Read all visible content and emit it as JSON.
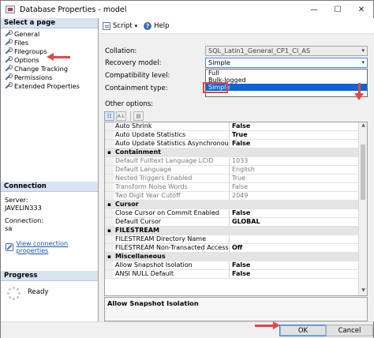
{
  "window": {
    "title": "Database Properties - model",
    "minimize": "—",
    "maximize": "☐",
    "close": "✕"
  },
  "left": {
    "select_page_header": "Select a page",
    "pages": [
      "General",
      "Files",
      "Filegroups",
      "Options",
      "Change Tracking",
      "Permissions",
      "Extended Properties"
    ],
    "connection_header": "Connection",
    "server_label": "Server:",
    "server_value": "JAVELIN333",
    "connection_label": "Connection:",
    "connection_value": "sa",
    "view_connection_link": "View connection properties",
    "progress_header": "Progress",
    "progress_status": "Ready"
  },
  "toolbar": {
    "script_label": "Script",
    "help_label": "Help"
  },
  "form": {
    "collation_label": "Collation:",
    "collation_value": "SQL_Latin1_General_CP1_CI_AS",
    "recovery_label": "Recovery model:",
    "recovery_value": "Simple",
    "compat_label": "Compatibility level:",
    "containment_label": "Containment type:",
    "other_label": "Other options:",
    "recovery_options": [
      "Full",
      "Bulk-logged",
      "Simple"
    ]
  },
  "grid": {
    "rows": [
      {
        "name": "Auto Shrink",
        "value": "False",
        "readonly": false
      },
      {
        "name": "Auto Update Statistics",
        "value": "True",
        "readonly": false
      },
      {
        "name": "Auto Update Statistics Asynchronously",
        "value": "False",
        "readonly": false
      },
      {
        "category": "Containment"
      },
      {
        "name": "Default Fulltext Language LCID",
        "value": "1033",
        "readonly": true
      },
      {
        "name": "Default Language",
        "value": "English",
        "readonly": true
      },
      {
        "name": "Nested Triggers Enabled",
        "value": "True",
        "readonly": true
      },
      {
        "name": "Transform Noise Words",
        "value": "False",
        "readonly": true
      },
      {
        "name": "Two Digit Year Cutoff",
        "value": "2049",
        "readonly": true
      },
      {
        "category": "Cursor"
      },
      {
        "name": "Close Cursor on Commit Enabled",
        "value": "False",
        "readonly": false
      },
      {
        "name": "Default Cursor",
        "value": "GLOBAL",
        "readonly": false
      },
      {
        "category": "FILESTREAM"
      },
      {
        "name": "FILESTREAM Directory Name",
        "value": "",
        "readonly": false
      },
      {
        "name": "FILESTREAM Non-Transacted Access",
        "value": "Off",
        "readonly": false
      },
      {
        "category": "Miscellaneous"
      },
      {
        "name": "Allow Snapshot Isolation",
        "value": "False",
        "readonly": false
      },
      {
        "name": "ANSI NULL Default",
        "value": "False",
        "readonly": false
      }
    ]
  },
  "description": "Allow Snapshot Isolation",
  "footer": {
    "ok_label": "OK",
    "cancel_label": "Cancel"
  },
  "colors": {
    "accent": "#0a64d6",
    "annotation": "#e04848",
    "link": "#1a57b4"
  }
}
